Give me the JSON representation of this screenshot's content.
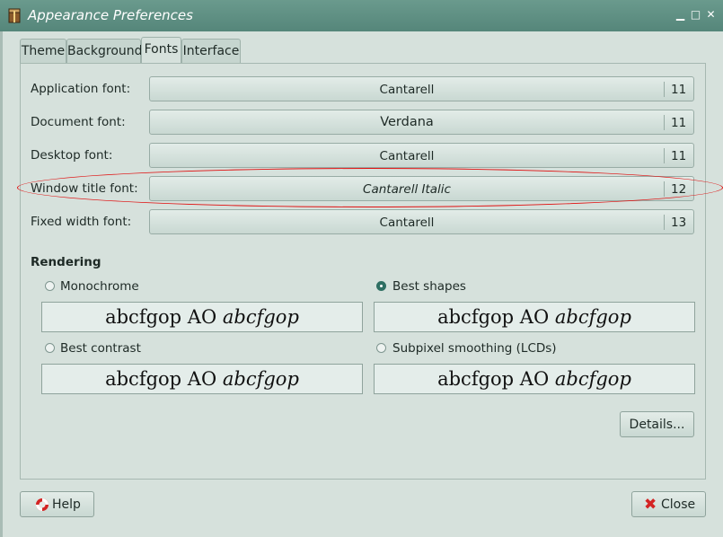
{
  "window": {
    "title": "Appearance Preferences"
  },
  "tabs": [
    {
      "label": "Theme"
    },
    {
      "label": "Background"
    },
    {
      "label": "Fonts"
    },
    {
      "label": "Interface"
    }
  ],
  "fonts": [
    {
      "label": "Application font:",
      "font": "Cantarell",
      "size": "11"
    },
    {
      "label": "Document font:",
      "font": "Verdana",
      "size": "11"
    },
    {
      "label": "Desktop font:",
      "font": "Cantarell",
      "size": "11"
    },
    {
      "label": "Window title font:",
      "font": "Cantarell Italic",
      "size": "12"
    },
    {
      "label": "Fixed width font:",
      "font": "Cantarell",
      "size": "13"
    }
  ],
  "rendering": {
    "title": "Rendering",
    "sample_regular": "abcfgop AO ",
    "sample_italic": "abcfgop",
    "options": [
      {
        "label": "Monochrome",
        "selected": false
      },
      {
        "label": "Best shapes",
        "selected": true
      },
      {
        "label": "Best contrast",
        "selected": false
      },
      {
        "label": "Subpixel smoothing (LCDs)",
        "selected": false
      }
    ]
  },
  "buttons": {
    "details": "Details...",
    "help": "Help",
    "close": "Close"
  },
  "colors": {
    "titlebar": "#5f9184",
    "annotation": "#e01010",
    "accent": "#2f6f63"
  }
}
